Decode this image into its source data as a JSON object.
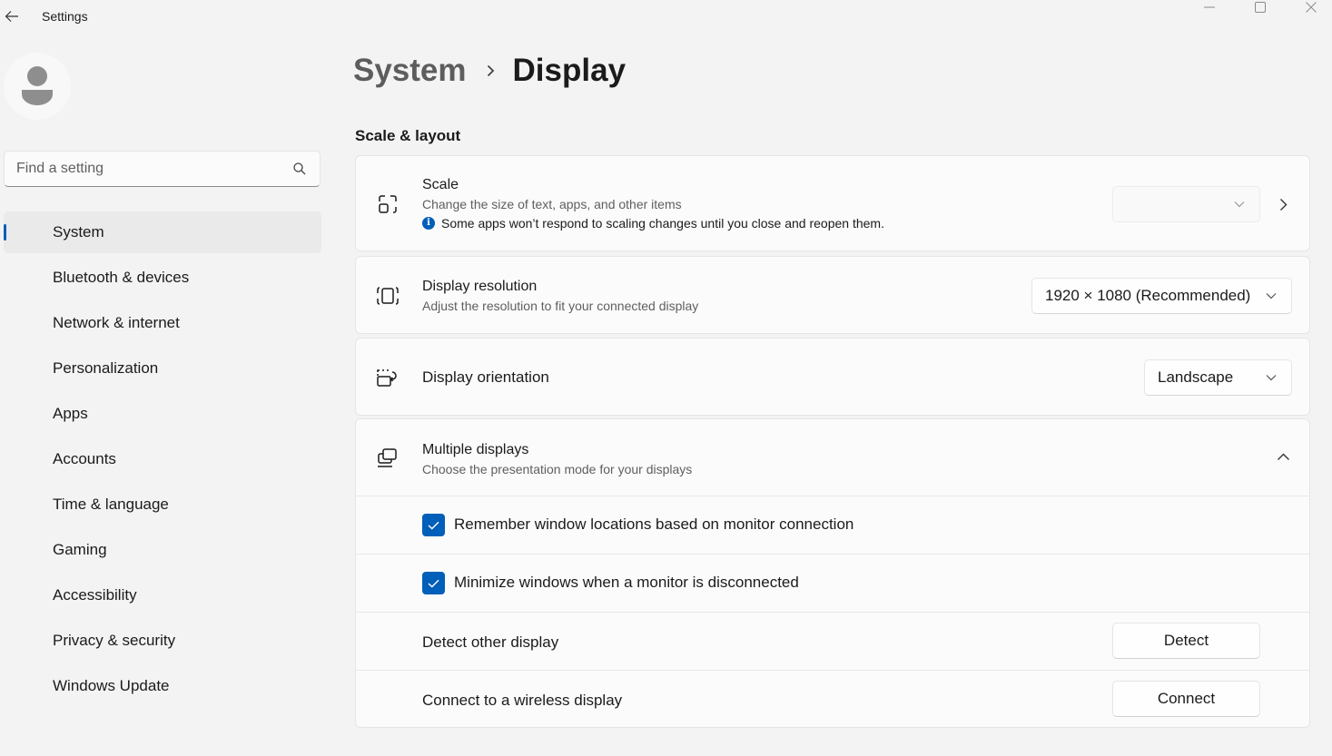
{
  "window": {
    "app_title": "Settings",
    "controls": {
      "minimize": "minimize-icon",
      "maximize": "maximize-icon",
      "close": "close-icon"
    }
  },
  "sidebar": {
    "search": {
      "placeholder": "Find a setting",
      "value": ""
    },
    "items": [
      {
        "label": "System",
        "active": true
      },
      {
        "label": "Bluetooth & devices",
        "active": false
      },
      {
        "label": "Network & internet",
        "active": false
      },
      {
        "label": "Personalization",
        "active": false
      },
      {
        "label": "Apps",
        "active": false
      },
      {
        "label": "Accounts",
        "active": false
      },
      {
        "label": "Time & language",
        "active": false
      },
      {
        "label": "Gaming",
        "active": false
      },
      {
        "label": "Accessibility",
        "active": false
      },
      {
        "label": "Privacy & security",
        "active": false
      },
      {
        "label": "Windows Update",
        "active": false
      }
    ]
  },
  "breadcrumb": {
    "parent": "System",
    "current": "Display"
  },
  "section": {
    "title": "Scale & layout"
  },
  "scale": {
    "title": "Scale",
    "subtitle": "Change the size of text, apps, and other items",
    "info": "Some apps won’t respond to scaling changes until you close and reopen them.",
    "value": ""
  },
  "resolution": {
    "title": "Display resolution",
    "subtitle": "Adjust the resolution to fit your connected display",
    "value": "1920 × 1080 (Recommended)"
  },
  "orientation": {
    "title": "Display orientation",
    "value": "Landscape"
  },
  "multiple_displays": {
    "title": "Multiple displays",
    "subtitle": "Choose the presentation mode for your displays",
    "expanded": true,
    "options": [
      {
        "label": "Remember window locations based on monitor connection",
        "checked": true
      },
      {
        "label": "Minimize windows when a monitor is disconnected",
        "checked": true
      }
    ],
    "detect": {
      "label": "Detect other display",
      "button": "Detect"
    },
    "wireless": {
      "label": "Connect to a wireless display",
      "button": "Connect"
    }
  },
  "colors": {
    "accent": "#005fb8",
    "background": "#f3f3f3",
    "card": "#fbfbfb"
  }
}
